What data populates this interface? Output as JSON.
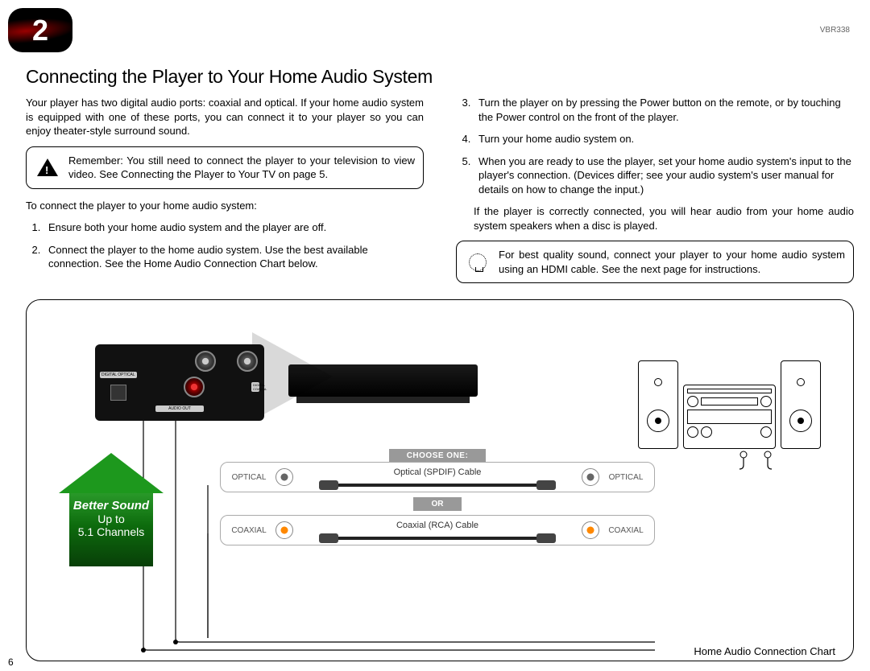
{
  "chapter_number": "2",
  "model": "VBR338",
  "heading": "Connecting the Player to Your Home Audio System",
  "page_number": "6",
  "intro_paragraph": "Your player has two digital audio ports: coaxial and optical. If your home audio system is equipped with one of these ports, you can connect it to your player so you can enjoy theater-style surround sound.",
  "reminder_box": "Remember: You still need to connect the player to your television to view video. See Connecting the Player to Your TV on page 5.",
  "lead_in": "To connect the player to your home audio system:",
  "steps_col1": [
    "Ensure both your home audio system and the player are off.",
    "Connect the player to the home audio system. Use the best available connection. See the Home Audio Connection Chart below."
  ],
  "steps_col2": [
    "Turn the player on by pressing the Power button on the remote, or by touching the Power control on the front of the player.",
    "Turn your home audio system on.",
    "When you are ready to use the player, set your home audio system's input to the player's connection. (Devices differ; see your audio system's user manual for details on how to change the input.)"
  ],
  "result_paragraph": "If the player is correctly connected, you will hear audio from your home audio system speakers when a disc is played.",
  "tip_box": "For best quality sound, connect your player to your home audio system using an HDMI cable. See the next page for instructions.",
  "backpanel": {
    "digital_optical": "DIGITAL OPTICAL",
    "digital_coaxial": "DIGITAL COAXIAL",
    "audio_out": "AUDIO OUT"
  },
  "badge": {
    "line1": "Better Sound",
    "line2": "Up to",
    "line3": "5.1 Channels"
  },
  "chooser": {
    "header": "CHOOSE ONE:",
    "or": "OR",
    "optical_label": "OPTICAL",
    "coaxial_label": "COAXIAL",
    "optical_cable": "Optical (SPDIF) Cable",
    "coaxial_cable": "Coaxial (RCA) Cable"
  },
  "diagram_caption": "Home Audio Connection Chart"
}
